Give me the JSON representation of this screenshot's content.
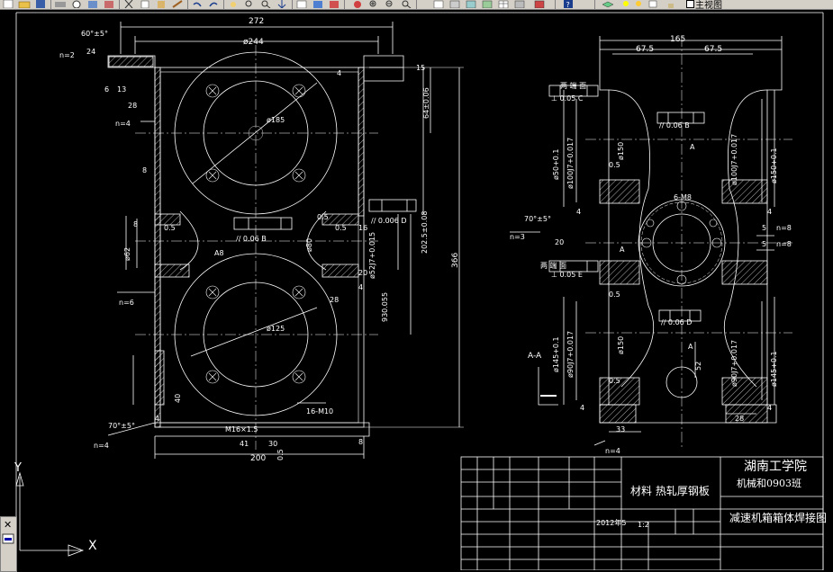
{
  "document": {
    "top_dims": {
      "d272": "272",
      "d244": "ø244",
      "d60": "60°±5°",
      "n2": "n=2",
      "d24": "24",
      "d6": "6",
      "d13": "13",
      "d28a": "28",
      "n4a": "n=4",
      "d8a": "8",
      "d8b": "8",
      "d15": "15",
      "d64": "64±0.06",
      "d4a": "4"
    },
    "center_labels": {
      "d185": "ø185",
      "d125": "ø125",
      "dA8": "A8",
      "par1": "// 0.06 B",
      "par2": "// 0.006 D",
      "d05a": "0.5",
      "d05b": "0.5",
      "d05c": "0.5",
      "d80": "ø80",
      "dd16": "16",
      "d2025": "202.5±0.08",
      "d366": "366",
      "d52": "ø52J7+0.015",
      "d930": "930.055",
      "d28b": "28",
      "d4b": "4",
      "d20": "20",
      "d16m10": "16-M10",
      "d8c": "8",
      "dn6": "n=6",
      "d62": "ø62",
      "d40": "40",
      "d4c": "4",
      "d70": "70°±5°",
      "dn4b": "n=4",
      "dm16": "M16×1.5",
      "d41": "41",
      "d30": "30",
      "d200": "200",
      "d05d": "0.5",
      "d8d": "8"
    },
    "right_view": {
      "d165": "165",
      "d675a": "67.5",
      "d675b": "67.5",
      "both_ends_1": "两 端 面",
      "perp1": "⊥ 0.05 C",
      "par3": "// 0.06 B",
      "d50": "ø50+0.1",
      "d100": "ø100J7+0.017",
      "d150a": "ø150",
      "dA1": "A",
      "d100r": "ø100J7+0.017",
      "d150b": "ø150+0.1",
      "d05e": "0.5",
      "d4d": "4",
      "d4e": "4",
      "d6m8": "6-M8",
      "d70b": "70°±5°",
      "dn3": "n=3",
      "d20b": "20",
      "dA2": "A",
      "both_ends_2": "两 端 面",
      "perp2": "⊥ 0.05 E",
      "dn8a": "n=8",
      "dn8b": "n=8",
      "d5a": "5",
      "d5b": "5",
      "d05f": "0.5",
      "par4": "// 0.06 D",
      "d145": "ø145+0.1",
      "d90": "ø90J7+0.017",
      "d150c": "ø150",
      "dA3": "A",
      "d90r": "ø90J7+0.017",
      "d145r": "ø145+0.1",
      "d05g": "0.5",
      "d4f": "4",
      "d4g": "4",
      "d52": "52",
      "d33": "33",
      "d28c": "28",
      "dn4c": "n=4",
      "aa": "A-A"
    },
    "title_block": {
      "school": "湖南工学院",
      "class_name": "机械和0903班",
      "material": "材料  热轧厚钢板",
      "drawing_title": "减速机箱箱体焊接图",
      "date": "2012年5",
      "scale": "1:2"
    }
  },
  "ui": {
    "view_label": "主视图",
    "axis_x": "X",
    "axis_y": "Y"
  }
}
